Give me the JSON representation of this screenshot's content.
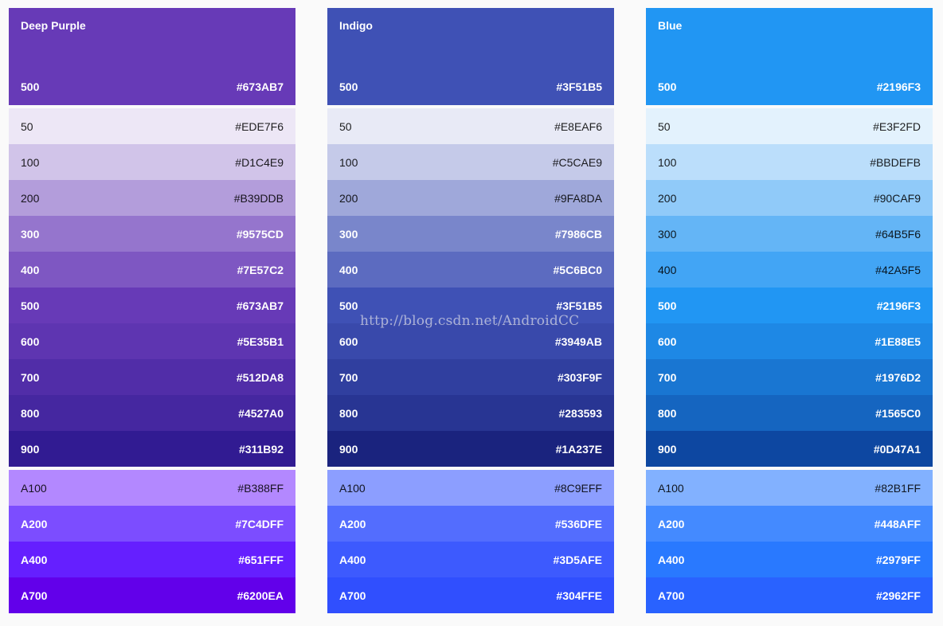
{
  "palettes": [
    {
      "name": "Deep Purple",
      "primary": {
        "shade": "500",
        "hex": "#673AB7",
        "color": "#673AB7"
      },
      "shades": [
        {
          "shade": "50",
          "hex": "#EDE7F6",
          "color": "#EDE7F6",
          "text": "dark"
        },
        {
          "shade": "100",
          "hex": "#D1C4E9",
          "color": "#D1C4E9",
          "text": "dark"
        },
        {
          "shade": "200",
          "hex": "#B39DDB",
          "color": "#B39DDB",
          "text": "dark"
        },
        {
          "shade": "300",
          "hex": "#9575CD",
          "color": "#9575CD",
          "text": "light"
        },
        {
          "shade": "400",
          "hex": "#7E57C2",
          "color": "#7E57C2",
          "text": "light"
        },
        {
          "shade": "500",
          "hex": "#673AB7",
          "color": "#673AB7",
          "text": "light"
        },
        {
          "shade": "600",
          "hex": "#5E35B1",
          "color": "#5E35B1",
          "text": "light"
        },
        {
          "shade": "700",
          "hex": "#512DA8",
          "color": "#512DA8",
          "text": "light"
        },
        {
          "shade": "800",
          "hex": "#4527A0",
          "color": "#4527A0",
          "text": "light"
        },
        {
          "shade": "900",
          "hex": "#311B92",
          "color": "#311B92",
          "text": "light"
        }
      ],
      "accents": [
        {
          "shade": "A100",
          "hex": "#B388FF",
          "color": "#B388FF",
          "text": "dark"
        },
        {
          "shade": "A200",
          "hex": "#7C4DFF",
          "color": "#7C4DFF",
          "text": "light"
        },
        {
          "shade": "A400",
          "hex": "#651FFF",
          "color": "#651FFF",
          "text": "light"
        },
        {
          "shade": "A700",
          "hex": "#6200EA",
          "color": "#6200EA",
          "text": "light"
        }
      ]
    },
    {
      "name": "Indigo",
      "primary": {
        "shade": "500",
        "hex": "#3F51B5",
        "color": "#3F51B5"
      },
      "shades": [
        {
          "shade": "50",
          "hex": "#E8EAF6",
          "color": "#E8EAF6",
          "text": "dark"
        },
        {
          "shade": "100",
          "hex": "#C5CAE9",
          "color": "#C5CAE9",
          "text": "dark"
        },
        {
          "shade": "200",
          "hex": "#9FA8DA",
          "color": "#9FA8DA",
          "text": "dark"
        },
        {
          "shade": "300",
          "hex": "#7986CB",
          "color": "#7986CB",
          "text": "light"
        },
        {
          "shade": "400",
          "hex": "#5C6BC0",
          "color": "#5C6BC0",
          "text": "light"
        },
        {
          "shade": "500",
          "hex": "#3F51B5",
          "color": "#3F51B5",
          "text": "light"
        },
        {
          "shade": "600",
          "hex": "#3949AB",
          "color": "#3949AB",
          "text": "light"
        },
        {
          "shade": "700",
          "hex": "#303F9F",
          "color": "#303F9F",
          "text": "light"
        },
        {
          "shade": "800",
          "hex": "#283593",
          "color": "#283593",
          "text": "light"
        },
        {
          "shade": "900",
          "hex": "#1A237E",
          "color": "#1A237E",
          "text": "light"
        }
      ],
      "accents": [
        {
          "shade": "A100",
          "hex": "#8C9EFF",
          "color": "#8C9EFF",
          "text": "dark"
        },
        {
          "shade": "A200",
          "hex": "#536DFE",
          "color": "#536DFE",
          "text": "light"
        },
        {
          "shade": "A400",
          "hex": "#3D5AFE",
          "color": "#3D5AFE",
          "text": "light"
        },
        {
          "shade": "A700",
          "hex": "#304FFE",
          "color": "#304FFE",
          "text": "light"
        }
      ]
    },
    {
      "name": "Blue",
      "primary": {
        "shade": "500",
        "hex": "#2196F3",
        "color": "#2196F3"
      },
      "shades": [
        {
          "shade": "50",
          "hex": "#E3F2FD",
          "color": "#E3F2FD",
          "text": "dark"
        },
        {
          "shade": "100",
          "hex": "#BBDEFB",
          "color": "#BBDEFB",
          "text": "dark"
        },
        {
          "shade": "200",
          "hex": "#90CAF9",
          "color": "#90CAF9",
          "text": "dark"
        },
        {
          "shade": "300",
          "hex": "#64B5F6",
          "color": "#64B5F6",
          "text": "dark"
        },
        {
          "shade": "400",
          "hex": "#42A5F5",
          "color": "#42A5F5",
          "text": "dark"
        },
        {
          "shade": "500",
          "hex": "#2196F3",
          "color": "#2196F3",
          "text": "light"
        },
        {
          "shade": "600",
          "hex": "#1E88E5",
          "color": "#1E88E5",
          "text": "light"
        },
        {
          "shade": "700",
          "hex": "#1976D2",
          "color": "#1976D2",
          "text": "light"
        },
        {
          "shade": "800",
          "hex": "#1565C0",
          "color": "#1565C0",
          "text": "light"
        },
        {
          "shade": "900",
          "hex": "#0D47A1",
          "color": "#0D47A1",
          "text": "light"
        }
      ],
      "accents": [
        {
          "shade": "A100",
          "hex": "#82B1FF",
          "color": "#82B1FF",
          "text": "dark"
        },
        {
          "shade": "A200",
          "hex": "#448AFF",
          "color": "#448AFF",
          "text": "light"
        },
        {
          "shade": "A400",
          "hex": "#2979FF",
          "color": "#2979FF",
          "text": "light"
        },
        {
          "shade": "A700",
          "hex": "#2962FF",
          "color": "#2962FF",
          "text": "light"
        }
      ]
    }
  ],
  "watermark": "http://blog.csdn.net/AndroidCC"
}
